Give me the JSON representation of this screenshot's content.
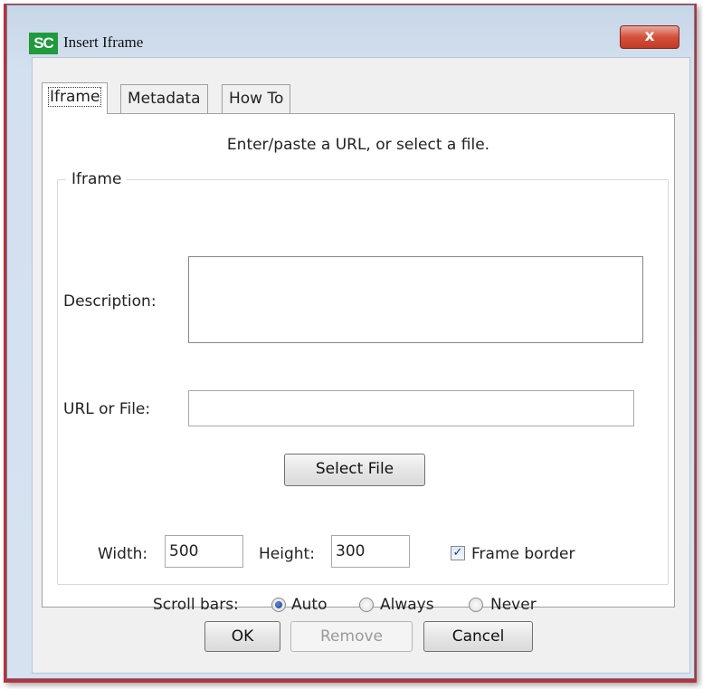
{
  "window": {
    "title": "Insert Iframe",
    "app_icon_text": "SC",
    "close_glyph": "x"
  },
  "tabs": [
    {
      "label": "Iframe",
      "active": true
    },
    {
      "label": "Metadata",
      "active": false
    },
    {
      "label": "How To",
      "active": false
    }
  ],
  "panel": {
    "instructions": "Enter/paste a URL, or select a file.",
    "group_label": "Iframe",
    "description_label": "Description:",
    "description_value": "",
    "url_label": "URL or File:",
    "url_value": "",
    "select_file_label": "Select File",
    "width_label": "Width:",
    "width_value": "500",
    "height_label": "Height:",
    "height_value": "300",
    "frame_border_label": "Frame border",
    "frame_border_checked": true,
    "scroll_label": "Scroll bars:",
    "scroll_options": [
      {
        "label": "Auto",
        "selected": true
      },
      {
        "label": "Always",
        "selected": false
      },
      {
        "label": "Never",
        "selected": false
      }
    ]
  },
  "footer": {
    "ok_label": "OK",
    "remove_label": "Remove",
    "cancel_label": "Cancel"
  },
  "colors": {
    "frame_accent": "#b9313a",
    "title_gradient": "#c7d6e8",
    "icon_green": "#1f9a3d",
    "close_red": "#d4503a"
  }
}
